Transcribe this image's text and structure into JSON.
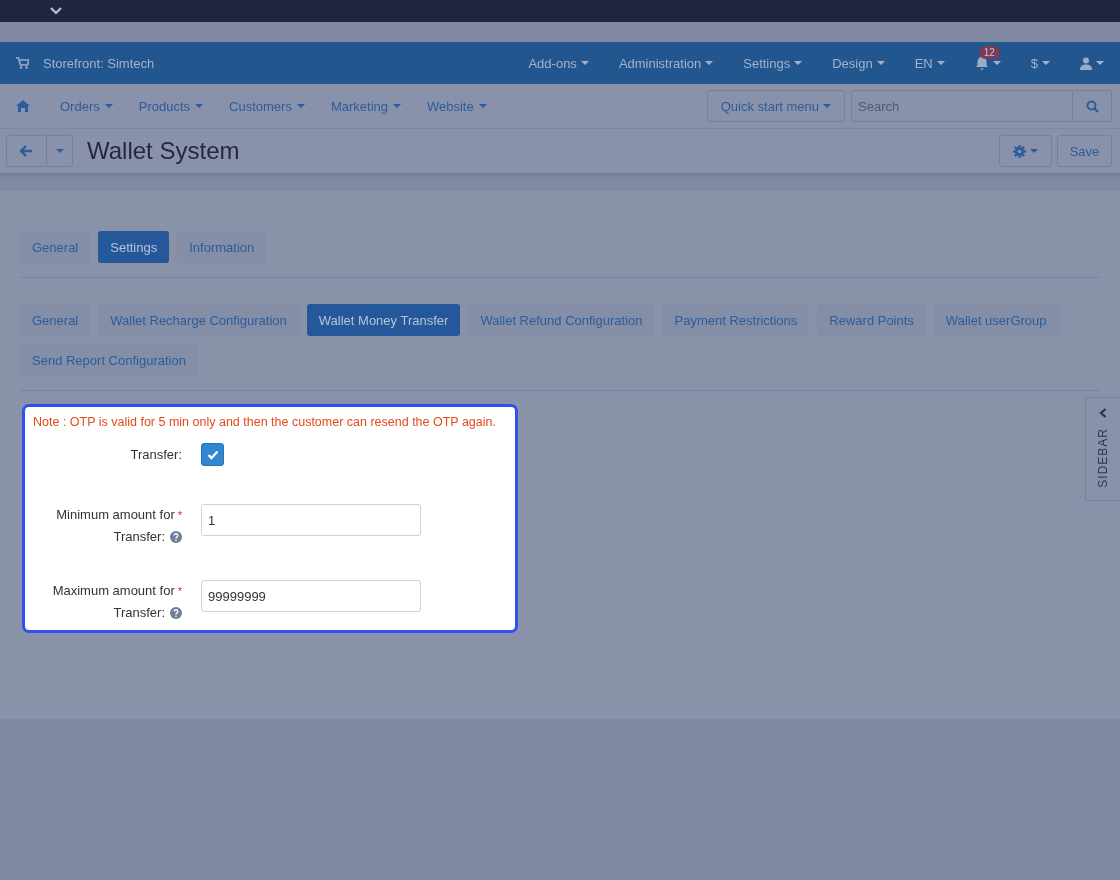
{
  "header": {
    "store": "Storefront: Simtech",
    "menus": [
      "Add-ons",
      "Administration",
      "Settings",
      "Design",
      "EN"
    ],
    "notifications": {
      "count": "12"
    },
    "currency": "$"
  },
  "nav": {
    "items": [
      "Orders",
      "Products",
      "Customers",
      "Marketing",
      "Website"
    ],
    "quick_start": "Quick start menu",
    "search": {
      "placeholder": "Search"
    }
  },
  "page": {
    "title": "Wallet System",
    "save": "Save"
  },
  "tabs": [
    {
      "label": "General",
      "selected": false
    },
    {
      "label": "Settings",
      "selected": true
    },
    {
      "label": "Information",
      "selected": false
    }
  ],
  "subtabs": [
    {
      "label": "General",
      "selected": false
    },
    {
      "label": "Wallet Recharge Configuration",
      "selected": false
    },
    {
      "label": "Wallet Money Transfer",
      "selected": true
    },
    {
      "label": "Wallet Refund Configuration",
      "selected": false
    },
    {
      "label": "Payment Restrictions",
      "selected": false
    },
    {
      "label": "Reward Points",
      "selected": false
    },
    {
      "label": "Wallet userGroup",
      "selected": false
    },
    {
      "label": "Send Report Configuration",
      "selected": false
    }
  ],
  "note": "Note : OTP is valid for 5 min only and then the customer can resend the OTP again.",
  "fields": [
    {
      "kind": "checkbox",
      "label_lines": [
        "Transfer:"
      ],
      "checked": true
    },
    {
      "kind": "text",
      "label_lines": [
        "Minimum amount for",
        "Transfer:"
      ],
      "required_mark": "*",
      "help": true,
      "value": "1"
    },
    {
      "kind": "text",
      "label_lines": [
        "Maximum amount for",
        "Transfer:"
      ],
      "required_mark": "*",
      "help": true,
      "value": "99999999"
    }
  ],
  "sidebar": {
    "label": "SIDEBAR"
  }
}
